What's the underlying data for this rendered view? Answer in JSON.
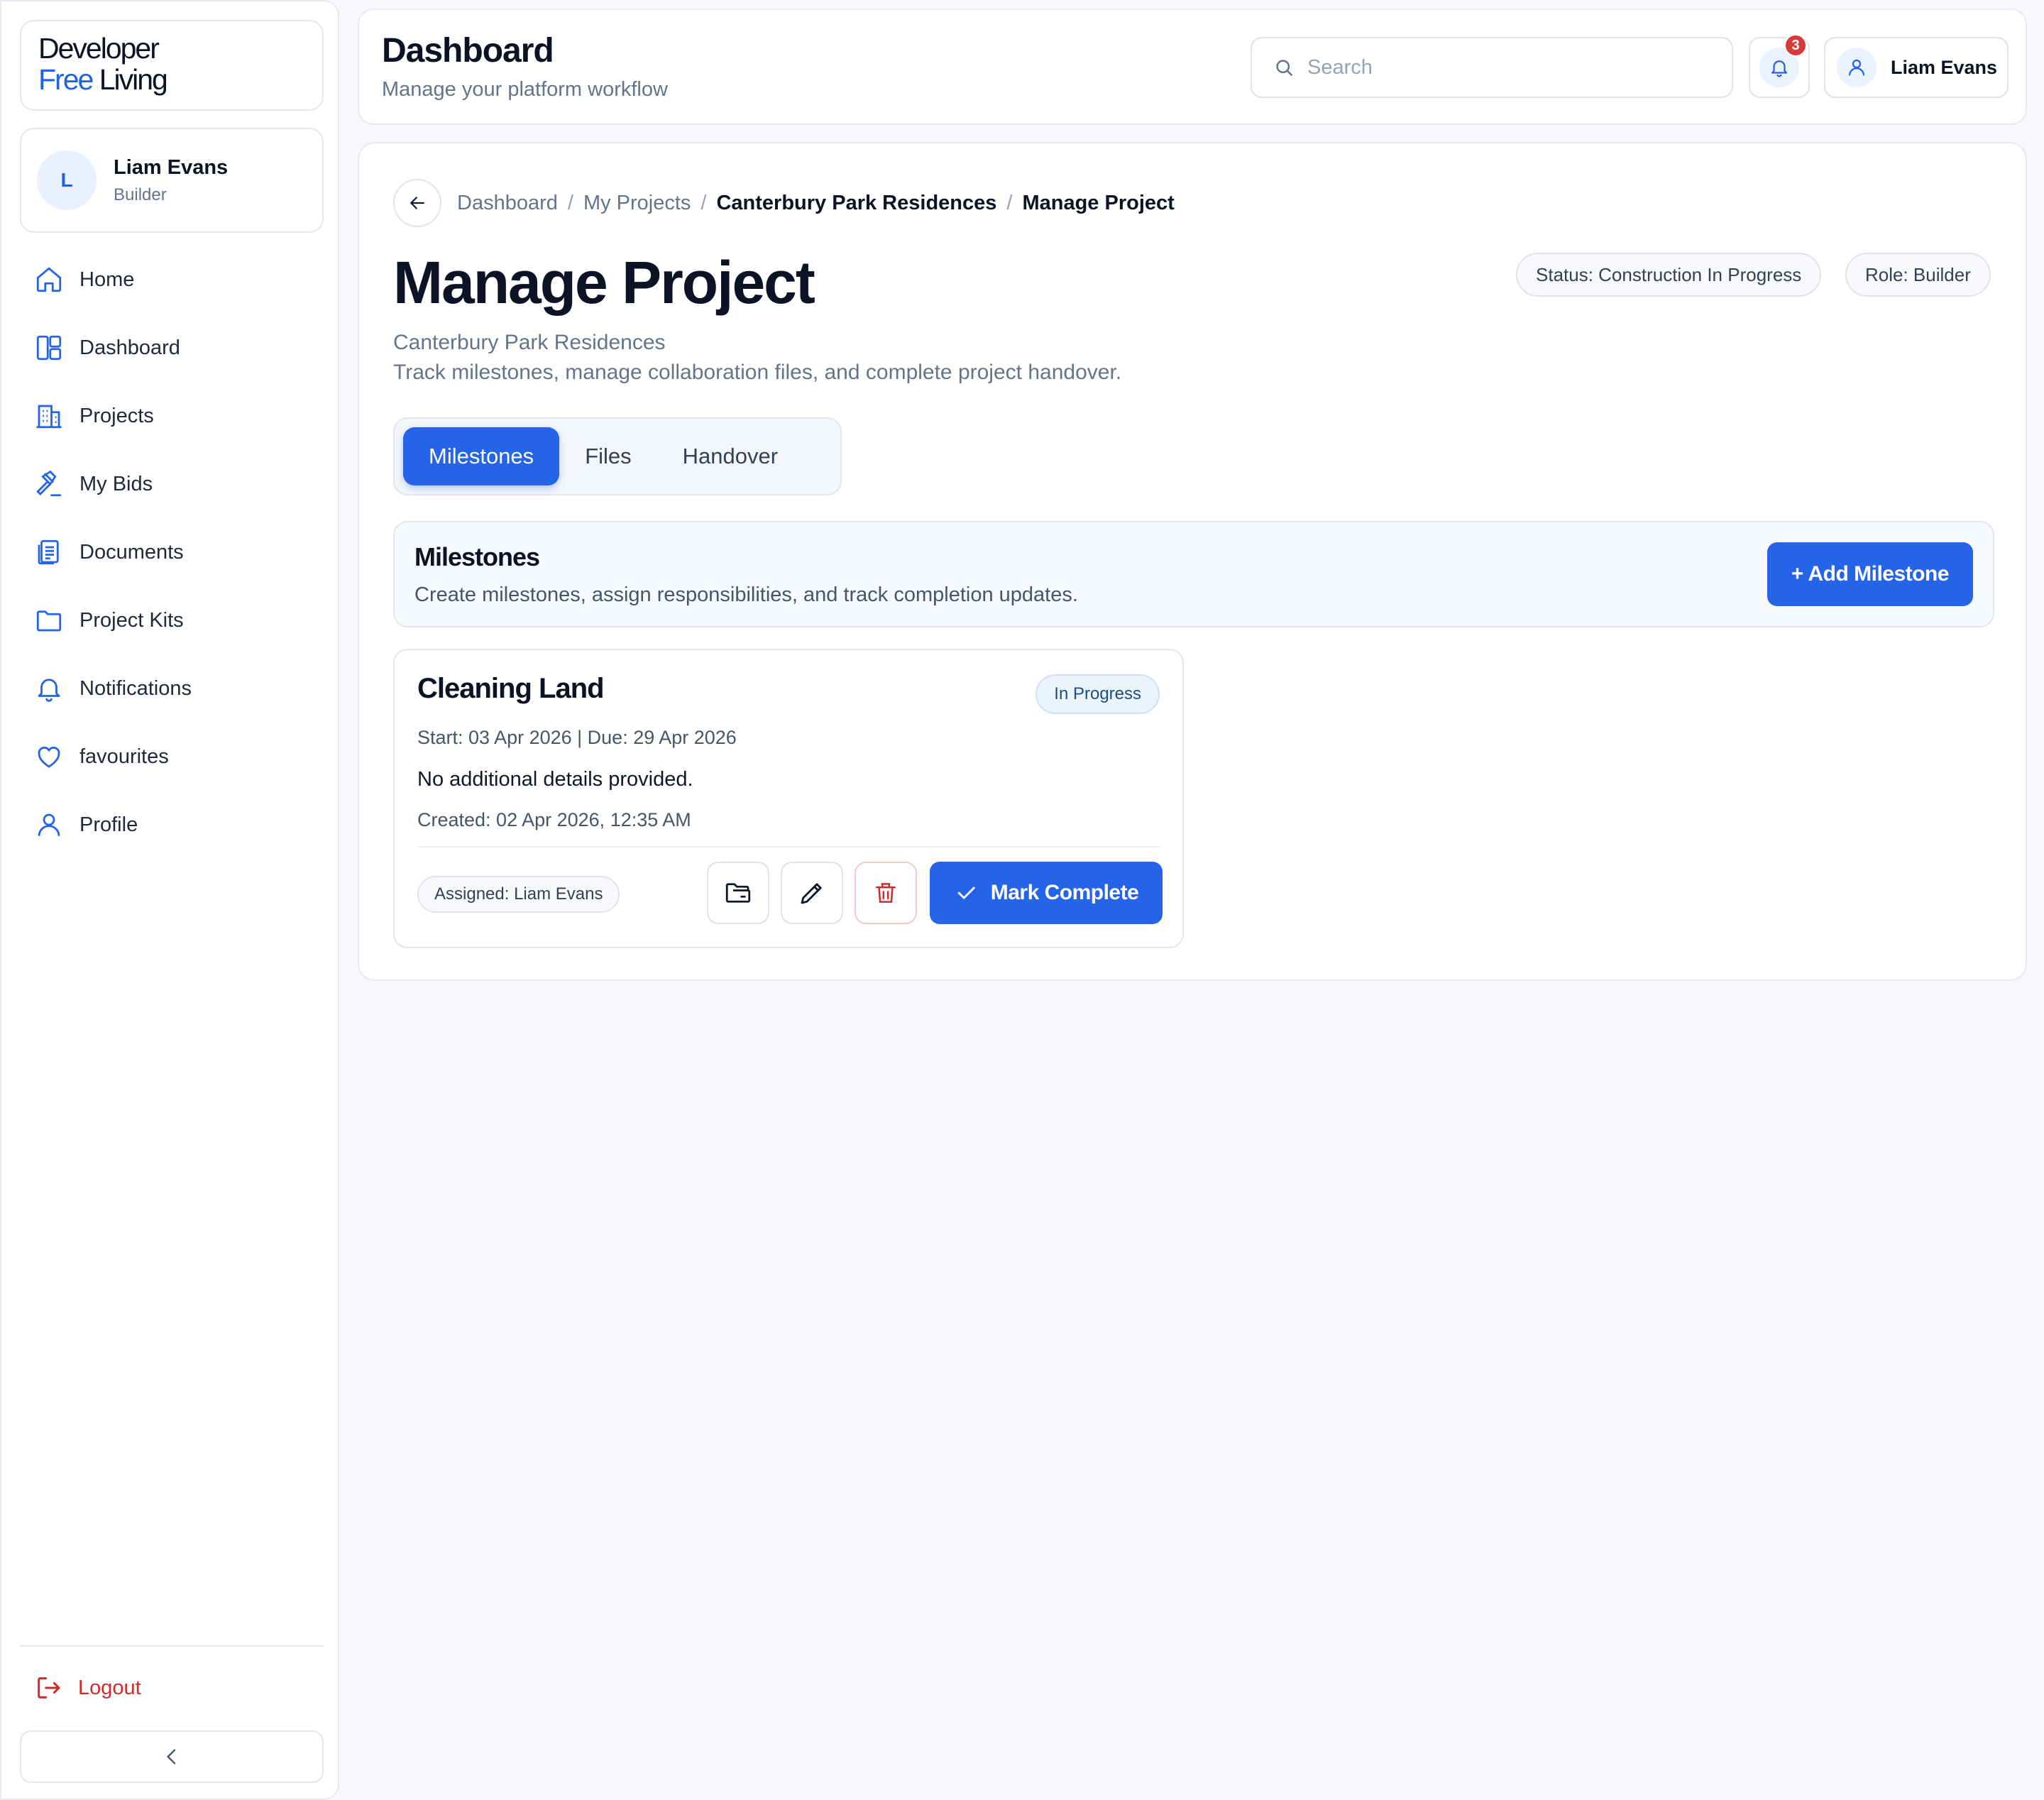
{
  "brand": {
    "line1": "Developer",
    "line2_accent": "Free",
    "line2_rest": " Living"
  },
  "user": {
    "initial": "L",
    "name": "Liam Evans",
    "role": "Builder"
  },
  "sidebar": {
    "items": [
      {
        "label": "Home",
        "icon": "home-icon"
      },
      {
        "label": "Dashboard",
        "icon": "dashboard-icon"
      },
      {
        "label": "Projects",
        "icon": "building-icon"
      },
      {
        "label": "My Bids",
        "icon": "gavel-icon"
      },
      {
        "label": "Documents",
        "icon": "document-icon"
      },
      {
        "label": "Project Kits",
        "icon": "folder-icon"
      },
      {
        "label": "Notifications",
        "icon": "bell-icon"
      },
      {
        "label": "favourites",
        "icon": "heart-icon"
      },
      {
        "label": "Profile",
        "icon": "user-icon"
      }
    ],
    "logout_label": "Logout"
  },
  "header": {
    "title": "Dashboard",
    "subtitle": "Manage your platform workflow",
    "search_placeholder": "Search",
    "notification_count": "3",
    "user_name": "Liam Evans"
  },
  "breadcrumb": [
    "Dashboard",
    "My Projects",
    "Canterbury Park Residences",
    "Manage Project"
  ],
  "page": {
    "title": "Manage Project",
    "status_pill": "Status: Construction In Progress",
    "role_pill": "Role: Builder",
    "project_name": "Canterbury Park Residences",
    "description": "Track milestones, manage collaboration files, and complete project handover."
  },
  "tabs": [
    {
      "label": "Milestones",
      "active": true
    },
    {
      "label": "Files",
      "active": false
    },
    {
      "label": "Handover",
      "active": false
    }
  ],
  "milestones_panel": {
    "title": "Milestones",
    "subtitle": "Create milestones, assign responsibilities, and track completion updates.",
    "add_label": "+ Add Milestone"
  },
  "milestone": {
    "title": "Cleaning Land",
    "status": "In Progress",
    "dates": "Start: 03 Apr 2026 | Due: 29 Apr 2026",
    "details": "No additional details provided.",
    "created": "Created: 02 Apr 2026, 12:35 AM",
    "assigned": "Assigned: Liam Evans",
    "complete_label": "Mark Complete"
  },
  "colors": {
    "accent": "#2563e8",
    "danger": "#d12c2c",
    "badge": "#d63a3a"
  }
}
